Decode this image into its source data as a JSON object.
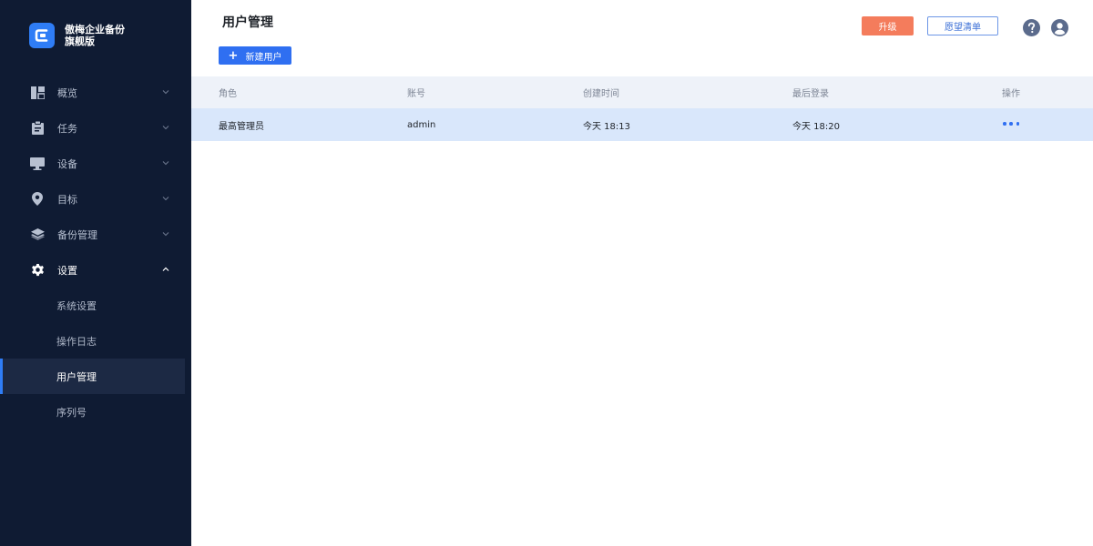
{
  "brand": {
    "line1": "傲梅企业备份",
    "line2": "旗舰版"
  },
  "sidebar": {
    "items": [
      {
        "label": "概览",
        "icon": "dashboard-icon"
      },
      {
        "label": "任务",
        "icon": "clipboard-icon"
      },
      {
        "label": "设备",
        "icon": "monitor-icon"
      },
      {
        "label": "目标",
        "icon": "location-pin-icon"
      },
      {
        "label": "备份管理",
        "icon": "layers-icon"
      },
      {
        "label": "设置",
        "icon": "gear-icon"
      }
    ],
    "sub_items": [
      {
        "label": "系统设置"
      },
      {
        "label": "操作日志"
      },
      {
        "label": "用户管理"
      },
      {
        "label": "序列号"
      }
    ]
  },
  "header": {
    "title": "用户管理",
    "new_user_label": "新建用户",
    "upgrade_label": "升级",
    "wishlist_label": "愿望清单"
  },
  "table": {
    "columns": [
      "角色",
      "账号",
      "创建时间",
      "最后登录",
      "操作"
    ],
    "rows": [
      {
        "role": "最高管理员",
        "account": "admin",
        "created": "今天 18:13",
        "last_login": "今天 18:20"
      }
    ]
  },
  "colors": {
    "sidebar_bg": "#0f1b33",
    "accent": "#2f6ff1",
    "upgrade": "#f47c5c",
    "selected_row": "#d9e7fb"
  }
}
